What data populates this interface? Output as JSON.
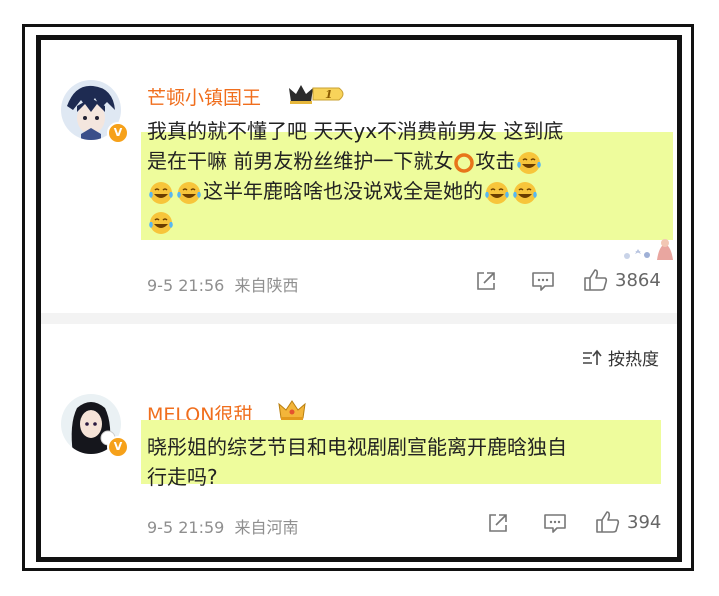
{
  "comments": [
    {
      "username": "芒顿小镇国王",
      "crown_level": "1",
      "verified_mark": "V",
      "text_line1": "我真的就不懂了吧 天天yx不消费前男友 这到底",
      "text_line2a": "是在干嘛 前男友粉丝维护一下就女",
      "text_line2b": "攻击",
      "text_line3": "这半年鹿晗啥也没说戏全是她的",
      "time": "9-5 21:56",
      "location": "来自陕西",
      "likes": "3864"
    },
    {
      "username": "MELON很甜",
      "verified_mark": "V",
      "text_line1": "晓彤姐的综艺节目和电视剧剧宣能离开鹿晗独自",
      "text_line2": "行走吗?",
      "time": "9-5 21:59",
      "location": "来自河南",
      "likes": "394"
    }
  ],
  "sort": {
    "label": "按热度"
  },
  "icons": [
    "share-icon",
    "comment-icon",
    "like-icon",
    "sort-icon",
    "laugh-cry-emoji",
    "red-circle-emoji",
    "crown-icon"
  ],
  "colors": {
    "username": "#f06e1d",
    "highlight": "#eefc9c",
    "meta": "#8f8f8f",
    "badge": "#f6a11a"
  }
}
